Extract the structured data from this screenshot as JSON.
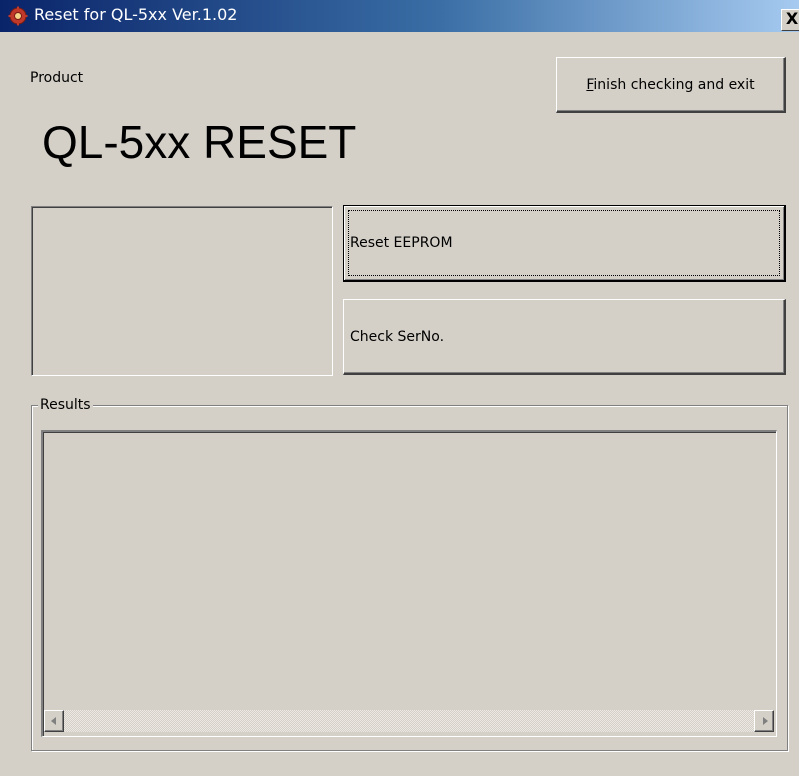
{
  "window": {
    "title": "Reset for QL-5xx Ver.1.02",
    "close_glyph": "X",
    "app_icon": "red-gear-app-icon"
  },
  "product": {
    "label": "Product",
    "name": "QL-5xx RESET"
  },
  "buttons": {
    "finish_mnemonic": "F",
    "finish_rest": "inish checking and exit",
    "reset_eeprom": "Reset EEPROM",
    "check_serno": "Check SerNo."
  },
  "results": {
    "label": "Results",
    "content": ""
  },
  "colors": {
    "face": "#d4d0c8",
    "title_start": "#0a246a",
    "title_end": "#a6caf0"
  }
}
